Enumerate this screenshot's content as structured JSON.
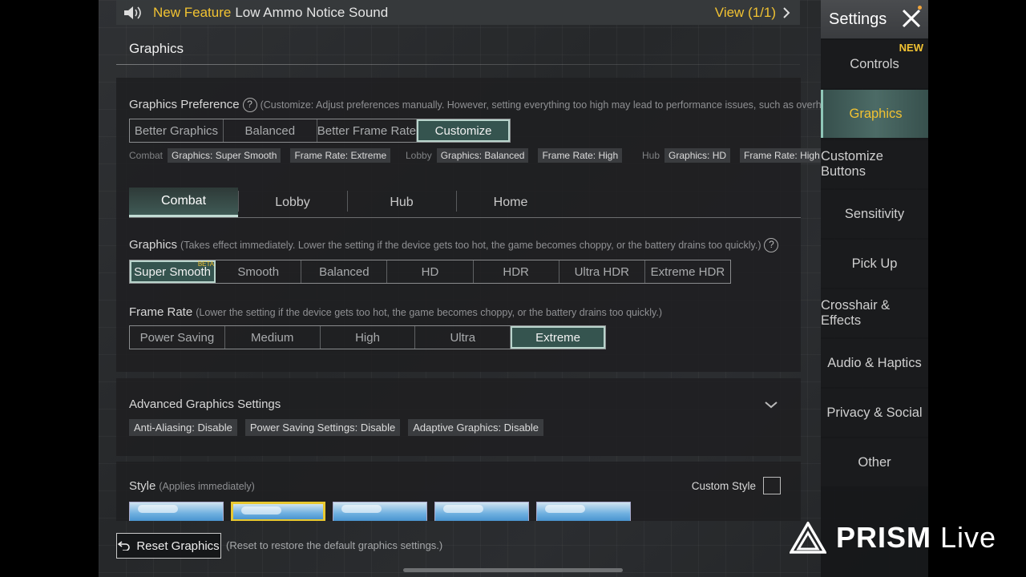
{
  "notice": {
    "new_label": "New Feature",
    "title": "Low Ammo Notice Sound",
    "view_label": "View (1/1)"
  },
  "section_title": "Graphics",
  "preference": {
    "label": "Graphics Preference",
    "hint": "(Customize: Adjust preferences manually. However, setting everything too high may lead to performance issues, such as overheat",
    "options": [
      "Better Graphics",
      "Balanced",
      "Better Frame Rate",
      "Customize"
    ],
    "selected": "Customize",
    "summary": {
      "combat": {
        "label": "Combat",
        "graphics": "Graphics: Super Smooth",
        "frame_rate": "Frame Rate: Extreme"
      },
      "lobby": {
        "label": "Lobby",
        "graphics": "Graphics: Balanced",
        "frame_rate": "Frame Rate: High"
      },
      "hub": {
        "label": "Hub",
        "graphics": "Graphics: HD",
        "frame_rate": "Frame Rate: High"
      }
    }
  },
  "mode_tabs": [
    "Combat",
    "Lobby",
    "Hub",
    "Home"
  ],
  "mode_selected": "Combat",
  "graphics_quality": {
    "label": "Graphics",
    "hint": "(Takes effect immediately. Lower the setting if the device gets too hot, the game becomes choppy, or the battery drains too quickly.)",
    "options": [
      "Super Smooth",
      "Smooth",
      "Balanced",
      "HD",
      "HDR",
      "Ultra HDR",
      "Extreme HDR"
    ],
    "selected": "Super Smooth",
    "beta_badge": "BETA"
  },
  "frame_rate": {
    "label": "Frame Rate",
    "hint": "(Lower the setting if the device gets too hot, the game becomes choppy, or the battery drains too quickly.)",
    "options": [
      "Power Saving",
      "Medium",
      "High",
      "Ultra",
      "Extreme"
    ],
    "selected": "Extreme"
  },
  "advanced": {
    "title": "Advanced Graphics Settings",
    "chips": [
      "Anti-Aliasing: Disable",
      "Power Saving Settings: Disable",
      "Adaptive Graphics: Disable"
    ]
  },
  "style": {
    "label": "Style",
    "hint": "(Applies immediately)",
    "custom_label": "Custom Style",
    "custom_checked": false,
    "selected_index": 1
  },
  "reset": {
    "label": "Reset Graphics",
    "hint": "(Reset to restore the default graphics settings.)"
  },
  "sidebar": {
    "title": "Settings",
    "new_tag": "NEW",
    "items": [
      "Controls",
      "Graphics",
      "Customize Buttons",
      "Sensitivity",
      "Pick Up",
      "Crosshair & Effects",
      "Audio & Haptics",
      "Privacy & Social",
      "Other"
    ],
    "selected": "Graphics"
  },
  "watermark": {
    "brand": "PRISM",
    "suffix": "Live"
  },
  "colors": {
    "accent_yellow": "#f1c232",
    "selected_teal": "#35544f",
    "selected_outline": "#b9d4cc"
  }
}
